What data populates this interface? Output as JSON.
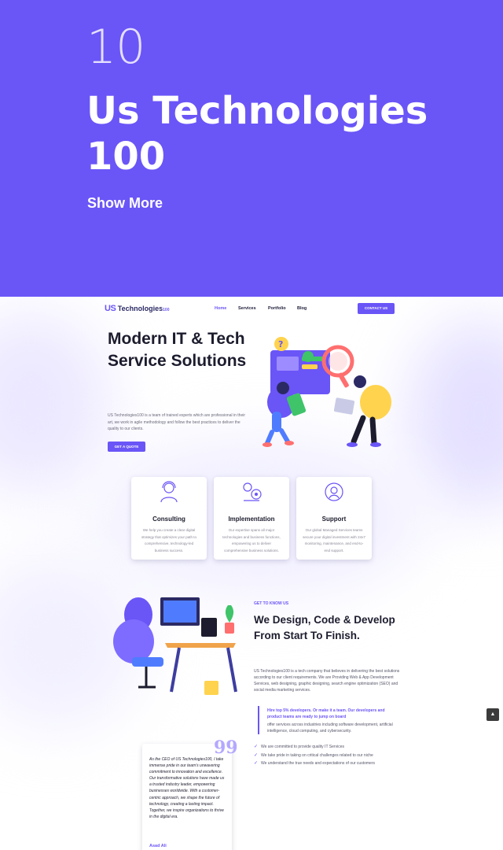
{
  "band": {
    "number": "10",
    "title": "Us Technologies 100",
    "show_more": "Show More",
    "color": "#6a55f7"
  },
  "site": {
    "logo_us": "US",
    "logo_name": "Technologies",
    "logo_suffix": "100",
    "nav": [
      "Home",
      "Services",
      "Portfolio",
      "Blog"
    ],
    "contact_button": "CONTACT US"
  },
  "hero": {
    "heading": "Modern IT & Tech Service Solutions",
    "intro": "US Technologies100 is a team of trained experts which are professional in their art, we work in agile methodology and follow the best practices to deliver the quality to our clients.",
    "quote_button": "GET A QUOTE"
  },
  "services": [
    {
      "icon": "consulting-headset-icon",
      "title": "Consulting",
      "text": "We help you create a clear digital strategy that optimizes your path to comprehensive, technology-led business success."
    },
    {
      "icon": "implementation-gears-icon",
      "title": "Implementation",
      "text": "Our expertise spans all major technologies and business functions, empowering us to deliver comprehensive business solutions."
    },
    {
      "icon": "support-agent-icon",
      "title": "Support",
      "text": "Our global Managed Services teams secure your digital investment with 24x7 monitoring, maintenance, and end-to-end support."
    }
  ],
  "about": {
    "eyebrow": "GET TO KNOW US",
    "heading": "We Design, Code & Develop From Start To Finish.",
    "paragraph": "US Technologies100 is a tech company that believes in delivering the best solutions according to our client requirements. We are Providing Web & App Development Services, web designing, graphic designing, search engine optimization (SEO) and social media marketing services.",
    "callout": "Hire top 5% developers. Or make it a team. Our developers and product teams are ready to jump on board",
    "callout_tail": "offer services across industries including software development, artificial intelligence, cloud computing, and cybersecurity.",
    "checklist": [
      "We are committed to provide quality IT Services",
      "We take pride in taking on critical challenges related to our niche",
      "We understand the true needs and expectations of our customers"
    ]
  },
  "testimonial": {
    "quote_mark": "99",
    "text": "As the CEO of US Technologies100, I take immense pride in our team's unwavering commitment to innovation and excellence. Our transformative solutions have made us a trusted industry leader, empowering businesses worldwide. With a customer-centric approach, we shape the future of technology, creating a lasting impact. Together, we inspire organizations to thrive in the digital era.",
    "author": "Asad Ali"
  },
  "scroll_top": "▲"
}
